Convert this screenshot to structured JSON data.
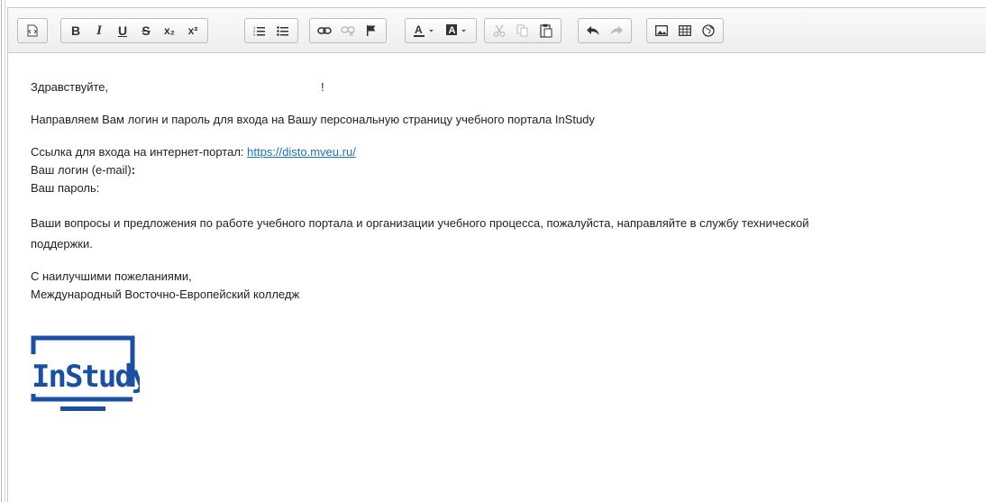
{
  "toolbar": {
    "groups": [
      [
        {
          "name": "source-icon",
          "glyph": "⎙"
        }
      ],
      [
        {
          "name": "bold-button",
          "glyph": "B"
        },
        {
          "name": "italic-button",
          "glyph": "I"
        },
        {
          "name": "underline-button",
          "glyph": "U"
        },
        {
          "name": "strike-button",
          "glyph": "S"
        },
        {
          "name": "subscript-button",
          "glyph": "x₂"
        },
        {
          "name": "superscript-button",
          "glyph": "x²"
        }
      ],
      [
        {
          "name": "numbered-list-button",
          "glyph": "☰"
        },
        {
          "name": "bulleted-list-button",
          "glyph": "☰"
        }
      ],
      [
        {
          "name": "link-button",
          "glyph": "∞"
        },
        {
          "name": "unlink-button",
          "glyph": "∞"
        },
        {
          "name": "anchor-button",
          "glyph": "⚑"
        }
      ],
      [
        {
          "name": "text-color-button",
          "glyph": "A"
        },
        {
          "name": "background-color-button",
          "glyph": "A"
        }
      ],
      [
        {
          "name": "cut-button",
          "glyph": "✂"
        },
        {
          "name": "copy-button",
          "glyph": "⧉"
        },
        {
          "name": "paste-button",
          "glyph": "📋"
        }
      ],
      [
        {
          "name": "undo-button",
          "glyph": "↶"
        },
        {
          "name": "redo-button",
          "glyph": "↷"
        }
      ],
      [
        {
          "name": "image-button",
          "glyph": "▣"
        },
        {
          "name": "table-button",
          "glyph": "▦"
        },
        {
          "name": "globe-button",
          "glyph": "◎"
        }
      ]
    ]
  },
  "content": {
    "greeting": "Здравствуйте,",
    "greeting_excl": "!",
    "intro": "Направляем Вам логин и пароль для входа на Вашу персональную страницу учебного портала InStudy",
    "link_label": "Ссылка для входа на интернет-портал: ",
    "link_url": "https://disto.mveu.ru/",
    "login_label": "Ваш логин (e-mail)",
    "login_colon": ":",
    "password_label": "Ваш пароль:",
    "support_line1": "Ваши вопросы и предложения по работе учебного портала и организации учебного процесса, пожалуйста, направляйте в службу технической",
    "support_line2": "поддержки.",
    "closing": "С наилучшими пожеланиями,",
    "signature": "Международный Восточно-Европейский колледж"
  },
  "logo": {
    "text": "InStudy",
    "color": "#1a4fa3"
  },
  "colors": {
    "link": "#1a73c8",
    "toolbar_bg": "#eeeeee"
  }
}
